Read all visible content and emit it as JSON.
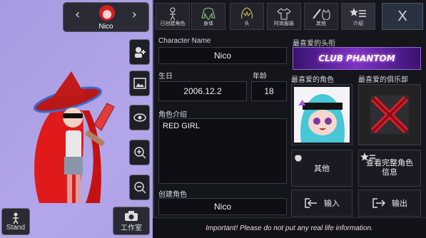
{
  "character": {
    "name": "Nico"
  },
  "stand_label": "Stand",
  "studio_label": "工作室",
  "tabs": [
    {
      "label": "已创建角色",
      "icon": "person-icon"
    },
    {
      "label": "身体",
      "icon": "jacket-icon"
    },
    {
      "label": "头",
      "icon": "hair-icon"
    },
    {
      "label": "时尚服装",
      "icon": "shirt-icon"
    },
    {
      "label": "其他",
      "icon": "sword-cat-icon"
    },
    {
      "label": "介绍",
      "icon": "star-list-icon"
    }
  ],
  "close_label": "X",
  "form": {
    "char_name_label": "Character Name",
    "char_name_value": "Nico",
    "birthday_label": "生日",
    "birthday_value": "2006.12.2",
    "age_label": "年龄",
    "age_value": "18",
    "intro_label": "角色介绍",
    "intro_value": "RED GIRL",
    "creator_label": "创建角色",
    "creator_value": "Nico"
  },
  "right": {
    "title_label": "最喜爱的头衔",
    "title_banner": "CLUB PHANTOM",
    "fav_char_label": "最喜爱的角色",
    "fav_club_label": "最喜爱的俱乐部",
    "other_label": "其他",
    "profile_label": "查看完整角色信息",
    "import_label": "输入",
    "export_label": "输出"
  },
  "notice": "Important! Please do not put any real life information.",
  "colors": {
    "panel": "#15151c",
    "accent_red": "#d42020",
    "banner": "#6a2bb0"
  }
}
